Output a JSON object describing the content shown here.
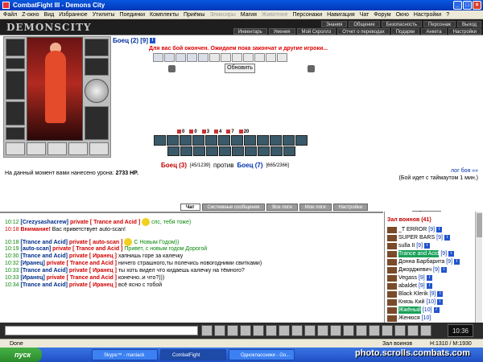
{
  "window": {
    "title": "CombatFight III - Demons City"
  },
  "menu": [
    "Файл",
    "Z-окно",
    "Вид",
    "Избранное",
    "Утилиты",
    "Поединки",
    "Комплекты",
    "Приёмы",
    "Эликсиры",
    "Магия",
    "Животное",
    "Персонажи",
    "Навигация",
    "Чат",
    "Форум",
    "Окно",
    "Настройки",
    "?"
  ],
  "header": {
    "logo": "DEMONSCITY",
    "nav_top": [
      "Знания",
      "Общение",
      "Безопасность",
      "Персонаж",
      "Выход"
    ],
    "nav_bottom": [
      "Инвентарь",
      "Умения",
      "Мой Скроллз",
      "Отчет о переводах",
      "Подарки",
      "Анкета",
      "Настройки"
    ]
  },
  "fighter": {
    "name": "Боец (2) [9]",
    "badge": "i"
  },
  "status_message": "Для вас бой окончен. Ожидаем пока закончат и другие игроки...",
  "refresh_label": "Обновить",
  "counts": [
    "0",
    "0",
    "3",
    "4",
    "7",
    "20"
  ],
  "versus": {
    "left": "Боец (3)",
    "left_hp": "[45/1239]",
    "vs": "против",
    "right": "Боец (7)",
    "right_hp": "[665/2366]"
  },
  "damage": {
    "label": "На данный момент вами нанесено урона:",
    "value": "2733 HP."
  },
  "log_link": "лог боя »»",
  "timeout_text": "(Бой идет с таймаутом 1 мин.)",
  "tabs": [
    "Чат",
    "Системные сообщения",
    "Все логи",
    "Мои логи",
    "Настройки"
  ],
  "chat": [
    {
      "time": "10:12",
      "nick": "[Crezysashacrew]",
      "priv": "private [ Trance and Acid ]",
      "text": "спс, тебя тоже)",
      "smile": true
    },
    {
      "time": "10:18",
      "time_red": true,
      "nick": "",
      "priv": "Внимание!",
      "text": "Вас приветствует auto-scan!",
      "smile": false
    },
    {
      "time": "10:18",
      "nick": "[Trance and Acid]",
      "priv": "private [ auto-scan ]",
      "text": "С Новым Годом))",
      "smile": true
    },
    {
      "time": "10:19",
      "nick": "[auto-scan]",
      "priv": "private [ Trance and Acid ]",
      "text": "Привет, с новым годом Дорогой",
      "smile": false
    },
    {
      "time": "10:30",
      "nick": "[Trance and Acid]",
      "priv": "private [ Иранец ]",
      "text": "хапнишь горе за калечку",
      "smile": false
    },
    {
      "time": "10:32",
      "nick": "[Иранец]",
      "priv": "private [ Trance and Acid ]",
      "text": "ничего страшного,ты полечись новогодними свитками)",
      "smile": false
    },
    {
      "time": "10:33",
      "nick": "[Trance and Acid]",
      "priv": "private [ Иранец ]",
      "text": "ты хоть видел что кидаешь калечку на тёмного?",
      "smile": false
    },
    {
      "time": "10:33",
      "nick": "[Иранец]",
      "priv": "private [ Trance and Acid ]",
      "text": "конечно..и что?)))",
      "smile": false
    },
    {
      "time": "10:34",
      "nick": "[Trance and Acid]",
      "priv": "private [ Иранец ]",
      "text": "всё ясно с тобой",
      "smile": false
    }
  ],
  "room": {
    "title": "Зал воинов (41)"
  },
  "players": [
    {
      "name": "_T ERROR",
      "lvl": "[9]",
      "hl": false
    },
    {
      "name": "SUPER BARS",
      "lvl": "[9]",
      "hl": false
    },
    {
      "name": "sulla II",
      "lvl": "[9]",
      "hl": false
    },
    {
      "name": "Trance and Acid",
      "lvl": "[9]",
      "hl": true
    },
    {
      "name": "Донна Барбарита",
      "lvl": "[9]",
      "hl": false
    },
    {
      "name": "Джорджевич",
      "lvl": "[9]",
      "hl": false
    },
    {
      "name": "Vegass",
      "lvl": "[9]",
      "hl": false
    },
    {
      "name": "abaldet",
      "lvl": "[9]",
      "hl": false
    },
    {
      "name": "Black Klerik",
      "lvl": "[9]",
      "hl": false
    },
    {
      "name": "Князь Кий",
      "lvl": "[10]",
      "hl": false
    },
    {
      "name": "Жжёный",
      "lvl": "[10]",
      "hl": true
    },
    {
      "name": "Женюся",
      "lvl": "[10]",
      "hl": false
    }
  ],
  "clock": "10:36",
  "statusbar": {
    "done": "Done",
    "zone": "Зал воинов",
    "hp": "H:1310 / M:1930"
  },
  "taskbar": {
    "start": "пуск",
    "tasks": [
      "Skype™ - maniack",
      "CombatFight",
      "Одноклассники - Go..."
    ]
  },
  "watermark": "photo.scrolls.combats.com"
}
